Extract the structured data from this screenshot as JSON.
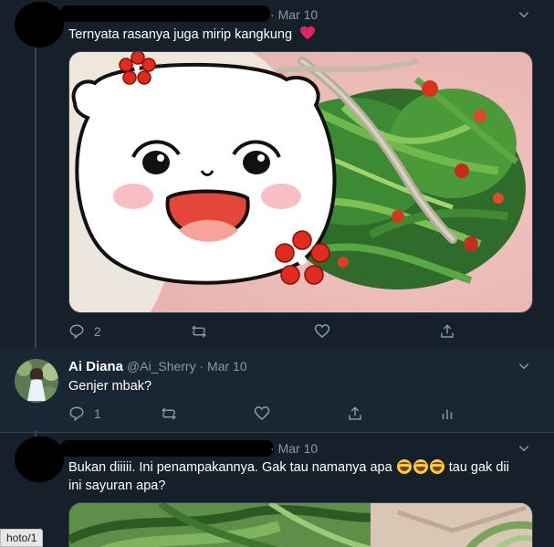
{
  "tweets": [
    {
      "name": "",
      "handle": "",
      "date": "Mar 10",
      "text": "Ternyata rasanya juga mirip kangkung",
      "text_emoji": "heart-icon",
      "actions": {
        "reply_count": "2",
        "retweet_count": "",
        "like_count": ""
      }
    },
    {
      "name": "Ai Diana",
      "handle": "@Ai_Sherry",
      "separator": "·",
      "date": "Mar 10",
      "text": "Genjer mbak?",
      "actions": {
        "reply_count": "1",
        "retweet_count": "",
        "like_count": ""
      }
    },
    {
      "name": "",
      "handle": "",
      "date": "Mar 10",
      "text_line1_before": "Bukan diiiii. Ini penampakannya. Gak tau namanya apa",
      "text_line1_after": "tau gak dii",
      "text_line2": "ini sayuran apa?",
      "emojis": [
        "rolling-laugh-emoji",
        "rolling-laugh-emoji",
        "rolling-laugh-emoji"
      ]
    }
  ],
  "status_bar": {
    "text": "hoto/1"
  },
  "colors": {
    "background": "#15202b",
    "highlight_background": "#192734",
    "muted": "#8899a6",
    "divider": "#38444d",
    "heart": "#e0245e"
  }
}
